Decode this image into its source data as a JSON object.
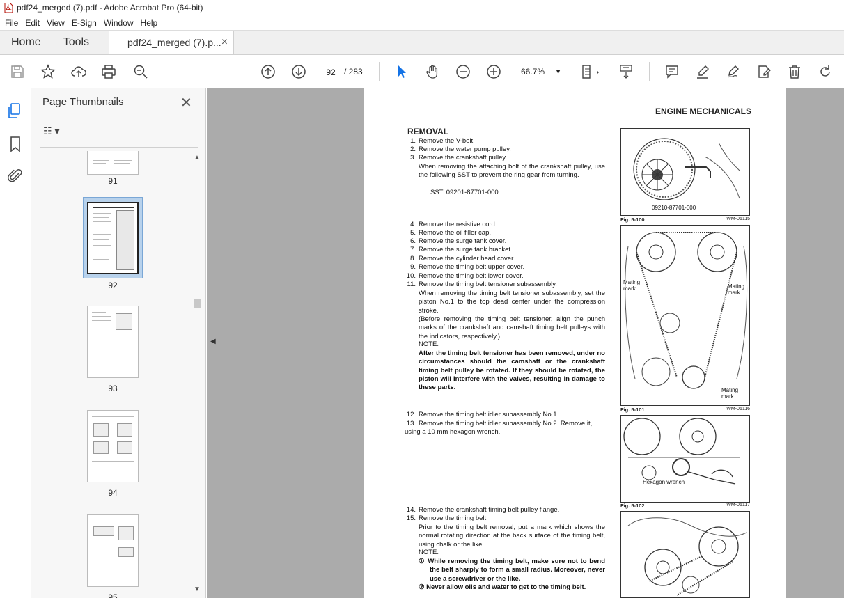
{
  "window": {
    "title": "pdf24_merged (7).pdf - Adobe Acrobat Pro (64-bit)"
  },
  "menu": [
    "File",
    "Edit",
    "View",
    "E-Sign",
    "Window",
    "Help"
  ],
  "tabs": {
    "home": "Home",
    "tools": "Tools",
    "document": "pdf24_merged (7).p...",
    "close": "×"
  },
  "toolbar": {
    "page_current": "92",
    "page_total": "/ 283",
    "zoom": "66.7%"
  },
  "thumbnails": {
    "title": "Page Thumbnails",
    "close": "✕",
    "pages": [
      "91",
      "92",
      "93",
      "94",
      "95"
    ],
    "selected": "92"
  },
  "document": {
    "header": "ENGINE MECHANICALS",
    "section": "REMOVAL",
    "steps_a": [
      {
        "n": "1.",
        "t": "Remove the V-belt."
      },
      {
        "n": "2.",
        "t": "Remove the water pump pulley."
      },
      {
        "n": "3.",
        "t": "Remove the crankshaft pulley."
      }
    ],
    "para_a": "When removing the attaching bolt of the crankshaft pulley, use the following SST to prevent the ring gear from turning.",
    "sst": "SST:   09201-87701-000",
    "steps_b": [
      {
        "n": "4.",
        "t": "Remove the resistive cord."
      },
      {
        "n": "5.",
        "t": "Remove the oil filler cap."
      },
      {
        "n": "6.",
        "t": "Remove the surge tank cover."
      },
      {
        "n": "7.",
        "t": "Remove the surge tank bracket."
      },
      {
        "n": "8.",
        "t": "Remove the cylinder head cover."
      },
      {
        "n": "9.",
        "t": "Remove the timing belt upper cover."
      },
      {
        "n": "10.",
        "t": "Remove the timing belt lower cover."
      },
      {
        "n": "11.",
        "t": "Remove the timing belt tensioner subassembly."
      }
    ],
    "para_b": "When removing the timing belt tensioner subassembly, set the piston No.1 to the top dead center under the compression stroke.",
    "para_b2": "(Before removing the timing belt tensioner, align the punch marks of the crankshaft and camshaft timing belt pulleys with the indicators, respectively.)",
    "note": "NOTE:",
    "note_b": "After the timing belt tensioner has been removed, under no circumstances should the camshaft or the crankshaft timing belt pulley be rotated. If they should be rotated, the piston will interfere with the valves, resulting in damage to these parts.",
    "steps_c": [
      {
        "n": "12.",
        "t": "Remove the timing belt idler subassembly No.1."
      },
      {
        "n": "13.",
        "t": "Remove the timing belt idler subassembly No.2. Remove it, using a 10 mm hexagon wrench."
      }
    ],
    "steps_d": [
      {
        "n": "14.",
        "t": "Remove the crankshaft timing belt pulley flange."
      },
      {
        "n": "15.",
        "t": "Remove the timing belt."
      }
    ],
    "para_d": "Prior to the timing belt removal, put a mark which shows the normal rotating direction at the back surface of the timing belt, using chalk or the like.",
    "note_d": [
      {
        "n": "①",
        "t": "While removing the timing belt, make sure not to bend the belt sharply to form a small radius. Moreover, never use a screwdriver or the like."
      },
      {
        "n": "②",
        "t": "Never allow oils and water to get to the timing belt."
      }
    ],
    "figures": [
      {
        "fig": "Fig. 5-100",
        "code": "WM-05115",
        "label": "09210-87701-000"
      },
      {
        "fig": "Fig. 5-101",
        "code": "WM-05116",
        "label1": "Mating mark",
        "label2": "Mating mark",
        "label3": "Mating mark"
      },
      {
        "fig": "Fig. 5-102",
        "code": "WM-05117",
        "label": "Hexagon wrench"
      }
    ]
  }
}
